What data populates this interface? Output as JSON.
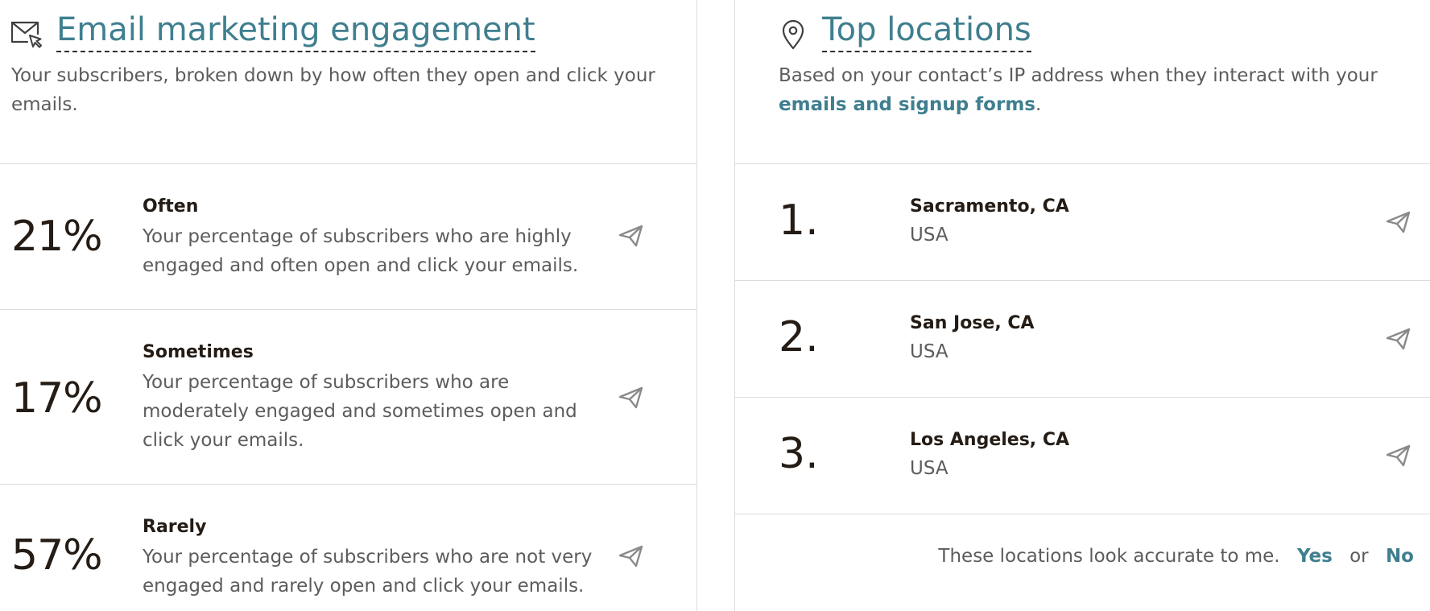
{
  "engagement": {
    "title": "Email marketing engagement",
    "icon": "mail-cursor-icon",
    "description": "Your subscribers, broken down by how often they open and click your emails.",
    "rows": [
      {
        "value": "21%",
        "label": "Often",
        "description": "Your percentage of subscribers who are highly engaged and often open and click your emails."
      },
      {
        "value": "17%",
        "label": "Sometimes",
        "description": "Your percentage of subscribers who are moderately engaged and sometimes open and click your emails."
      },
      {
        "value": "57%",
        "label": "Rarely",
        "description": "Your percentage of subscribers who are not very engaged and rarely open and click your emails."
      }
    ],
    "action_icon": "send-paper-plane-icon"
  },
  "locations": {
    "title": "Top locations",
    "icon": "map-pin-icon",
    "description_prefix": "Based on your contact’s IP address when they interact with your ",
    "description_link": "emails and signup forms",
    "description_suffix": ".",
    "items": [
      {
        "rank": "1.",
        "city": "Sacramento, CA",
        "country": "USA"
      },
      {
        "rank": "2.",
        "city": "San Jose, CA",
        "country": "USA"
      },
      {
        "rank": "3.",
        "city": "Los Angeles, CA",
        "country": "USA"
      }
    ],
    "feedback": {
      "prompt": "These locations look accurate to me.",
      "yes": "Yes",
      "or": "or",
      "no": "No"
    }
  },
  "colors": {
    "accent": "#3f7f8f",
    "text": "#241c15",
    "muted": "#5c5c5c",
    "divider": "#dcdcdc"
  }
}
